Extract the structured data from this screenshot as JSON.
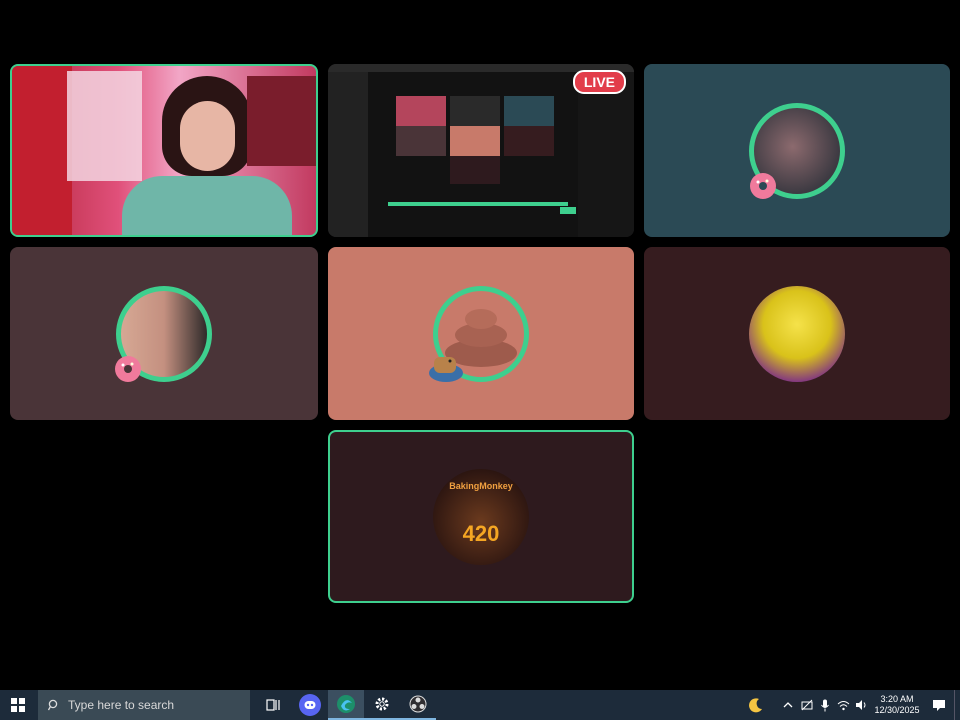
{
  "screen_share": {
    "live_badge": "LIVE"
  },
  "participants": [
    {
      "name": "participant-camera-streamer",
      "speaking": true
    },
    {
      "name": "participant-screen-share"
    },
    {
      "name": "participant-teal",
      "speaking": true
    },
    {
      "name": "participant-two-people",
      "speaking": true
    },
    {
      "name": "participant-poop",
      "speaking": true
    },
    {
      "name": "participant-anime"
    },
    {
      "name": "participant-bakingmonkey",
      "speaking": true
    }
  ],
  "avatar_text": {
    "monkey_title": "BakingMonkey",
    "monkey_number": "420"
  },
  "taskbar": {
    "search_placeholder": "Type here to search",
    "time": "3:20 AM",
    "date": "12/30/2025"
  },
  "colors": {
    "speaking_border": "#3ecf8e",
    "tile_teal": "#2b4a55",
    "tile_mauve": "#4a3438",
    "tile_salmon": "#c87a6a",
    "tile_dark_brown": "#361c1f",
    "tile_maroon": "#2e1a1e"
  }
}
